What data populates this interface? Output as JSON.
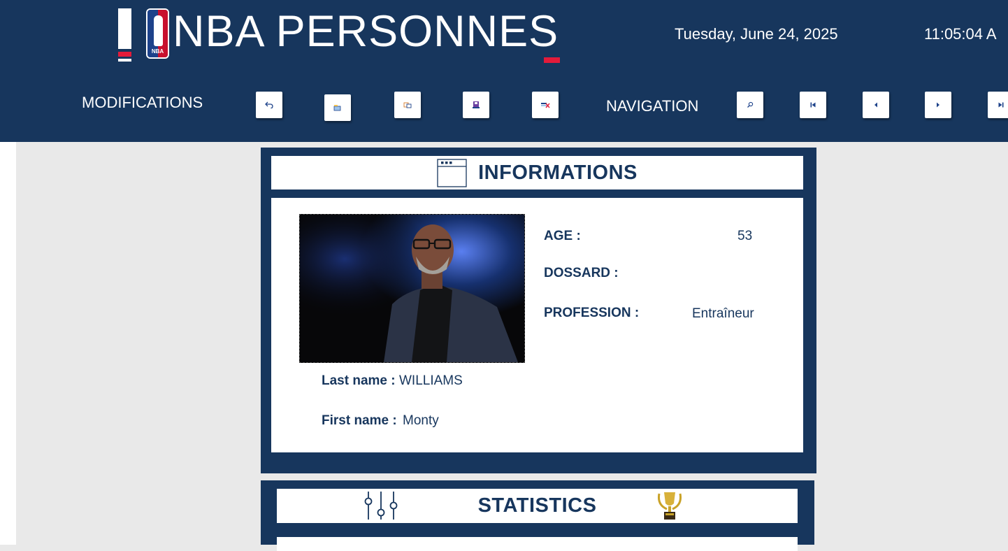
{
  "header": {
    "brand": "NBA PERSONNES",
    "logo_text": "NBA",
    "date": "Tuesday, June 24, 2025",
    "time": "11:05:04 A"
  },
  "toolbar": {
    "modifications_label": "MODIFICATIONS",
    "navigation_label": "NAVIGATION",
    "buttons": {
      "undo": "undo-icon",
      "new": "new-record-icon",
      "copy": "copy-icon",
      "save": "save-icon",
      "delete": "delete-icon",
      "search": "search-icon",
      "first": "first-record-icon",
      "previous": "previous-record-icon",
      "next": "next-record-icon",
      "last": "last-record-icon"
    }
  },
  "info": {
    "title": "INFORMATIONS",
    "age_label": "AGE :",
    "age_value": "53",
    "dossard_label": "DOSSARD :",
    "dossard_value": "",
    "profession_label": "PROFESSION :",
    "profession_value": "Entraîneur",
    "lastname_label": "Last name :",
    "lastname_value": "WILLIAMS",
    "firstname_label": "First name :",
    "firstname_value": "Monty"
  },
  "stats": {
    "title": "STATISTICS"
  },
  "colors": {
    "navy": "#17365d",
    "red": "#e31b3a",
    "nba_blue": "#1d428a",
    "gold": "#c9a227"
  }
}
